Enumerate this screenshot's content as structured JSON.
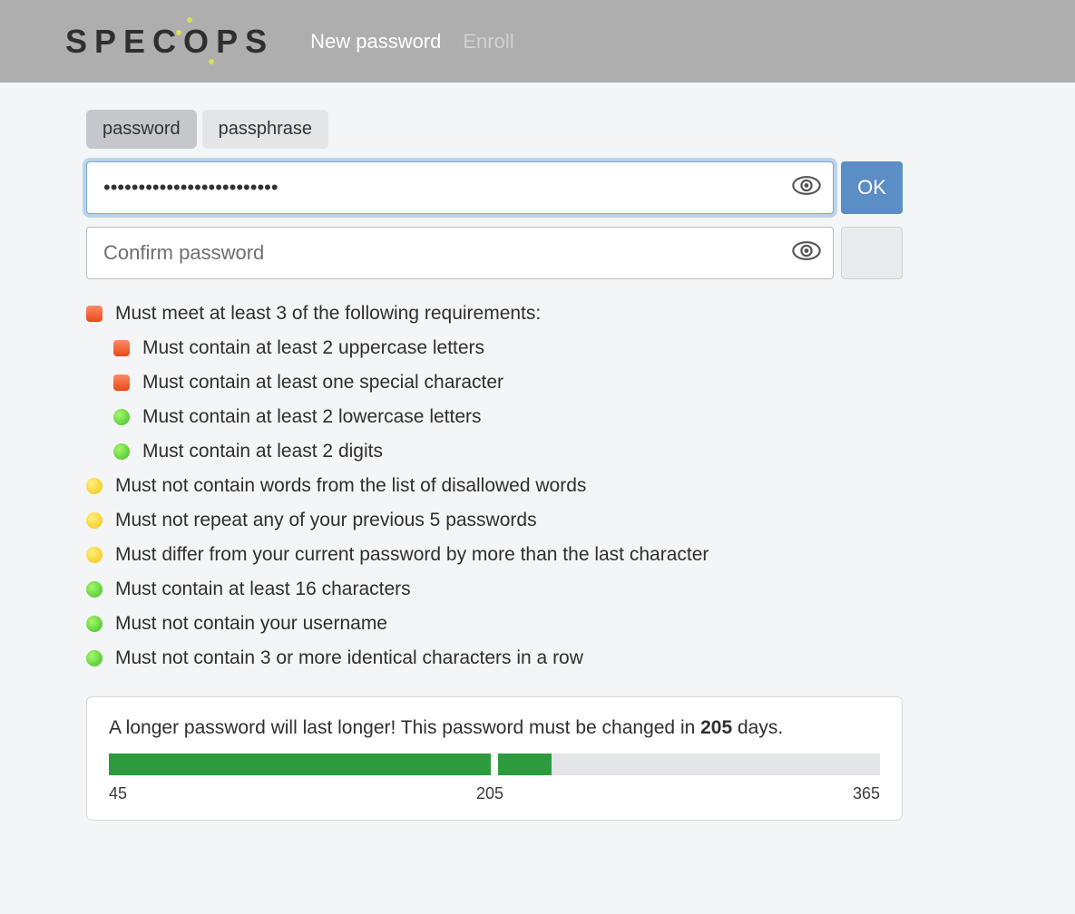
{
  "brand": "SPECOPS",
  "nav": {
    "new_password": "New password",
    "enroll": "Enroll"
  },
  "tabs": {
    "password": "password",
    "passphrase": "passphrase"
  },
  "inputs": {
    "password_value": "•••••••••••••••••••••••••",
    "confirm_placeholder": "Confirm password"
  },
  "buttons": {
    "ok": "OK"
  },
  "rules": {
    "header": "Must meet at least 3 of the following requirements:",
    "sub": [
      {
        "status": "red",
        "text": "Must contain at least 2 uppercase letters"
      },
      {
        "status": "red",
        "text": "Must contain at least one special character"
      },
      {
        "status": "green",
        "text": "Must contain at least 2 lowercase letters"
      },
      {
        "status": "green",
        "text": "Must contain at least 2 digits"
      }
    ],
    "main": [
      {
        "status": "yellow",
        "text": "Must not contain words from the list of disallowed words"
      },
      {
        "status": "yellow",
        "text": "Must not repeat any of your previous 5 passwords"
      },
      {
        "status": "yellow",
        "text": "Must differ from your current password by more than the last character"
      },
      {
        "status": "green",
        "text": "Must contain at least 16 characters"
      },
      {
        "status": "green",
        "text": "Must not contain your username"
      },
      {
        "status": "green",
        "text": "Must not contain 3 or more identical characters in a row"
      }
    ]
  },
  "strength": {
    "msg_prefix": "A longer password will last longer! This password must be changed in ",
    "days": "205",
    "msg_suffix": " days.",
    "min": "45",
    "current": "205",
    "max": "365",
    "seg1_width_pct": 50,
    "seg2_width_pct": 50,
    "seg2_fill_pct": 14
  }
}
